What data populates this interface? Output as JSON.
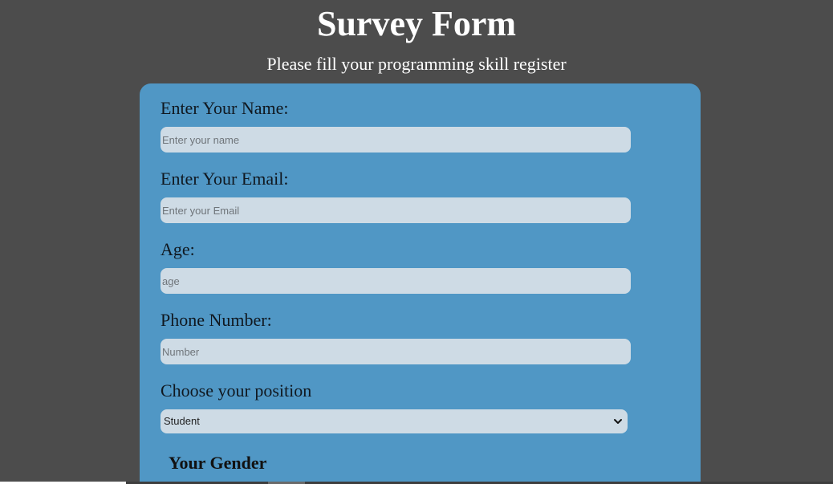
{
  "header": {
    "title": "Survey Form",
    "subtitle": "Please fill your programming skill register"
  },
  "form": {
    "name": {
      "label": "Enter Your Name:",
      "placeholder": "Enter your name",
      "value": ""
    },
    "email": {
      "label": "Enter Your Email:",
      "placeholder": "Enter your Email",
      "value": ""
    },
    "age": {
      "label": "Age:",
      "placeholder": "age",
      "value": ""
    },
    "phone": {
      "label": "Phone Number:",
      "placeholder": "Number",
      "value": ""
    },
    "position": {
      "label": "Choose your position",
      "selected": "Student",
      "icon": "chevron-down-icon"
    },
    "gender": {
      "heading": "Your Gender"
    }
  },
  "colors": {
    "page_background": "#4c4c4c",
    "card_background": "#5097c5",
    "input_background": "#cedbe5",
    "heading_text": "#ffffff"
  }
}
